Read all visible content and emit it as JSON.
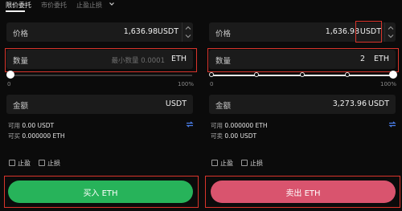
{
  "tabs": {
    "limit": "限价委托",
    "market": "市价委托",
    "stop": "止盈止损"
  },
  "buy": {
    "price_label": "价格",
    "price_value": "1,636.98",
    "price_unit": "USDT",
    "amount_label": "数量",
    "amount_placeholder": "最小数量 0.0001",
    "amount_unit": "ETH",
    "slider_min": "0",
    "slider_max": "100%",
    "slider_level_percent": 0,
    "total_label": "金额",
    "total_value": "",
    "total_unit": "USDT",
    "available_label": "可用",
    "available_value": "0.00 USDT",
    "can_buy_label": "可买",
    "can_buy_value": "0.000000 ETH",
    "take_profit": "止盈",
    "stop_loss": "止损",
    "button": "买入 ETH"
  },
  "sell": {
    "price_label": "价格",
    "price_value": "1,636.98",
    "price_unit": "USDT",
    "amount_label": "数量",
    "amount_value": "2",
    "amount_unit": "ETH",
    "slider_min": "0",
    "slider_max": "100%",
    "slider_level_percent": 100,
    "total_label": "金额",
    "total_value": "3,273.96",
    "total_unit": "USDT",
    "available_label": "可用",
    "available_value": "0.000000 ETH",
    "can_sell_label": "可卖",
    "can_sell_value": "0.00 USDT",
    "take_profit": "止盈",
    "stop_loss": "止损",
    "button": "卖出 ETH"
  },
  "colors": {
    "background": "#0b0b0b",
    "field": "#1b1b1b",
    "buy_button": "#27b35a",
    "sell_button": "#d9546e",
    "highlight": "#d9342b",
    "swap_icon": "#4a7de8"
  },
  "icons": {
    "dropdown": "chevron-down-icon",
    "stepper_up": "chevron-up-icon",
    "stepper_down": "chevron-down-icon",
    "swap": "swap-arrows-icon",
    "checkbox": "checkbox-icon"
  }
}
